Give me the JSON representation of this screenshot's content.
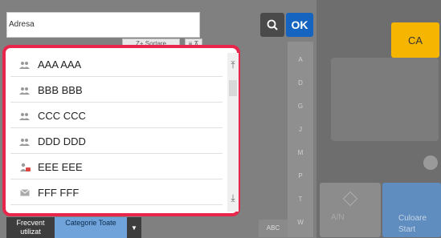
{
  "header": {
    "address_label": "Adresa",
    "ok_label": "OK",
    "sort_label": "Z+ Sortare",
    "sort_alt_label": "≡ ⊼"
  },
  "list": {
    "items": [
      {
        "label": "AAA AAA",
        "icon": "group-icon"
      },
      {
        "label": "BBB BBB",
        "icon": "group-icon"
      },
      {
        "label": "CCC CCC",
        "icon": "group-icon"
      },
      {
        "label": "DDD DDD",
        "icon": "group-icon"
      },
      {
        "label": "EEE EEE",
        "icon": "user-fax-icon"
      },
      {
        "label": "FFF FFF",
        "icon": "email-icon"
      }
    ]
  },
  "alphabet": {
    "letters": [
      "A",
      "D",
      "G",
      "J",
      "M",
      "P",
      "T",
      "W"
    ],
    "abc_label": "ABC"
  },
  "tabs": {
    "frequent_label": "Frecvent utilizat",
    "category_label": "Categorie Toate"
  },
  "right_panel": {
    "ca_label": "CA",
    "color_label_1": "Culoare",
    "color_label_2": "Start",
    "bw_label": "A/N"
  },
  "colors": {
    "highlight": "#e8254a",
    "ok": "#1565c0",
    "ca": "#f6b500",
    "tab_category": "#6fa3d9"
  }
}
